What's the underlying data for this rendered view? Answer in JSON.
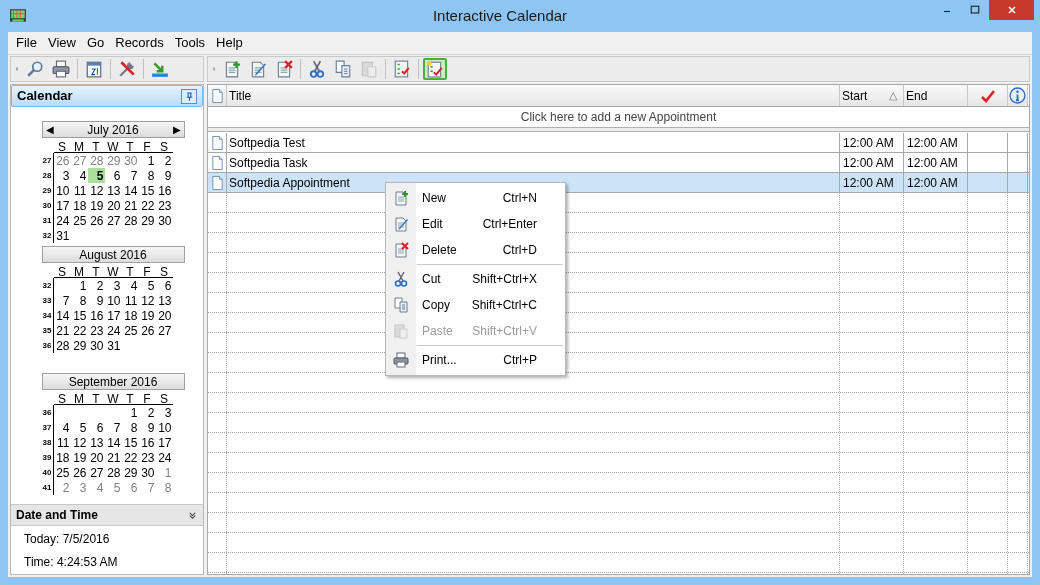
{
  "window": {
    "title": "Interactive Calendar"
  },
  "menu": [
    {
      "label": "File"
    },
    {
      "label": "View"
    },
    {
      "label": "Go"
    },
    {
      "label": "Records"
    },
    {
      "label": "Tools"
    },
    {
      "label": "Help"
    }
  ],
  "left_toolbar": [
    {
      "kind": "search",
      "on": false
    },
    {
      "kind": "print",
      "on": false
    },
    {
      "kind": "calendar",
      "on": false
    },
    {
      "kind": "tools",
      "on": false
    },
    {
      "kind": "export",
      "on": false
    }
  ],
  "right_toolbar": [
    {
      "kind": "new",
      "on": false,
      "disabled": false
    },
    {
      "kind": "edit",
      "on": false,
      "disabled": false
    },
    {
      "kind": "delete",
      "on": false,
      "disabled": false
    },
    {
      "kind": "separator"
    },
    {
      "kind": "cut",
      "on": false,
      "disabled": false
    },
    {
      "kind": "copy",
      "on": false,
      "disabled": false
    },
    {
      "kind": "paste",
      "on": false,
      "disabled": true
    },
    {
      "kind": "separator"
    },
    {
      "kind": "tasks",
      "on": false,
      "disabled": false
    },
    {
      "kind": "separator"
    },
    {
      "kind": "checklist",
      "on": true,
      "disabled": false
    }
  ],
  "calendar": {
    "title": "Calendar",
    "months": [
      {
        "title": "July 2016",
        "prev": "◀",
        "next": "▶",
        "weekdays": [
          "S",
          "M",
          "T",
          "W",
          "T",
          "F",
          "S"
        ],
        "weeks": [
          {
            "number": "27",
            "days": [
              {
                "text": "26",
                "kind": "adjacent",
                "selected": false
              },
              {
                "text": "27",
                "kind": "adjacent",
                "selected": false
              },
              {
                "text": "28",
                "kind": "adjacent",
                "selected": false
              },
              {
                "text": "29",
                "kind": "adjacent",
                "selected": false
              },
              {
                "text": "30",
                "kind": "adjacent",
                "selected": false
              },
              {
                "text": "1",
                "kind": "day",
                "selected": false
              },
              {
                "text": "2",
                "kind": "day",
                "selected": false
              }
            ]
          },
          {
            "number": "28",
            "days": [
              {
                "text": "3",
                "kind": "day",
                "selected": false
              },
              {
                "text": "4",
                "kind": "day",
                "selected": false
              },
              {
                "text": "5",
                "kind": "day",
                "selected": true
              },
              {
                "text": "6",
                "kind": "day",
                "selected": false
              },
              {
                "text": "7",
                "kind": "day",
                "selected": false
              },
              {
                "text": "8",
                "kind": "day",
                "selected": false
              },
              {
                "text": "9",
                "kind": "day",
                "selected": false
              }
            ]
          },
          {
            "number": "29",
            "days": [
              {
                "text": "10",
                "kind": "day",
                "selected": false
              },
              {
                "text": "11",
                "kind": "day",
                "selected": false
              },
              {
                "text": "12",
                "kind": "day",
                "selected": false
              },
              {
                "text": "13",
                "kind": "day",
                "selected": false
              },
              {
                "text": "14",
                "kind": "day",
                "selected": false
              },
              {
                "text": "15",
                "kind": "day",
                "selected": false
              },
              {
                "text": "16",
                "kind": "day",
                "selected": false
              }
            ]
          },
          {
            "number": "30",
            "days": [
              {
                "text": "17",
                "kind": "day",
                "selected": false
              },
              {
                "text": "18",
                "kind": "day",
                "selected": false
              },
              {
                "text": "19",
                "kind": "day",
                "selected": false
              },
              {
                "text": "20",
                "kind": "day",
                "selected": false
              },
              {
                "text": "21",
                "kind": "day",
                "selected": false
              },
              {
                "text": "22",
                "kind": "day",
                "selected": false
              },
              {
                "text": "23",
                "kind": "day",
                "selected": false
              }
            ]
          },
          {
            "number": "31",
            "days": [
              {
                "text": "24",
                "kind": "day",
                "selected": false
              },
              {
                "text": "25",
                "kind": "day",
                "selected": false
              },
              {
                "text": "26",
                "kind": "day",
                "selected": false
              },
              {
                "text": "27",
                "kind": "day",
                "selected": false
              },
              {
                "text": "28",
                "kind": "day",
                "selected": false
              },
              {
                "text": "29",
                "kind": "day",
                "selected": false
              },
              {
                "text": "30",
                "kind": "day",
                "selected": false
              }
            ]
          },
          {
            "number": "32",
            "days": [
              {
                "text": "31",
                "kind": "day",
                "selected": false
              }
            ]
          }
        ]
      },
      {
        "title": "August 2016",
        "weekdays": [
          "S",
          "M",
          "T",
          "W",
          "T",
          "F",
          "S"
        ],
        "weeks": [
          {
            "number": "32",
            "days": [
              {
                "kind": "blank"
              },
              {
                "text": "1",
                "kind": "day",
                "selected": false
              },
              {
                "text": "2",
                "kind": "day",
                "selected": false
              },
              {
                "text": "3",
                "kind": "day",
                "selected": false
              },
              {
                "text": "4",
                "kind": "day",
                "selected": false
              },
              {
                "text": "5",
                "kind": "day",
                "selected": false
              },
              {
                "text": "6",
                "kind": "day",
                "selected": false
              }
            ]
          },
          {
            "number": "33",
            "days": [
              {
                "text": "7",
                "kind": "day",
                "selected": false
              },
              {
                "text": "8",
                "kind": "day",
                "selected": false
              },
              {
                "text": "9",
                "kind": "day",
                "selected": false
              },
              {
                "text": "10",
                "kind": "day",
                "selected": false
              },
              {
                "text": "11",
                "kind": "day",
                "selected": false
              },
              {
                "text": "12",
                "kind": "day",
                "selected": false
              },
              {
                "text": "13",
                "kind": "day",
                "selected": false
              }
            ]
          },
          {
            "number": "34",
            "days": [
              {
                "text": "14",
                "kind": "day",
                "selected": false
              },
              {
                "text": "15",
                "kind": "day",
                "selected": false
              },
              {
                "text": "16",
                "kind": "day",
                "selected": false
              },
              {
                "text": "17",
                "kind": "day",
                "selected": false
              },
              {
                "text": "18",
                "kind": "day",
                "selected": false
              },
              {
                "text": "19",
                "kind": "day",
                "selected": false
              },
              {
                "text": "20",
                "kind": "day",
                "selected": false
              }
            ]
          },
          {
            "number": "35",
            "days": [
              {
                "text": "21",
                "kind": "day",
                "selected": false
              },
              {
                "text": "22",
                "kind": "day",
                "selected": false
              },
              {
                "text": "23",
                "kind": "day",
                "selected": false
              },
              {
                "text": "24",
                "kind": "day",
                "selected": false
              },
              {
                "text": "25",
                "kind": "day",
                "selected": false
              },
              {
                "text": "26",
                "kind": "day",
                "selected": false
              },
              {
                "text": "27",
                "kind": "day",
                "selected": false
              }
            ]
          },
          {
            "number": "36",
            "days": [
              {
                "text": "28",
                "kind": "day",
                "selected": false
              },
              {
                "text": "29",
                "kind": "day",
                "selected": false
              },
              {
                "text": "30",
                "kind": "day",
                "selected": false
              },
              {
                "text": "31",
                "kind": "day",
                "selected": false
              }
            ]
          }
        ]
      },
      {
        "title": "September 2016",
        "weekdays": [
          "S",
          "M",
          "T",
          "W",
          "T",
          "F",
          "S"
        ],
        "weeks": [
          {
            "number": "36",
            "days": [
              {
                "kind": "blank"
              },
              {
                "kind": "blank"
              },
              {
                "kind": "blank"
              },
              {
                "kind": "blank"
              },
              {
                "text": "1",
                "kind": "day",
                "selected": false
              },
              {
                "text": "2",
                "kind": "day",
                "selected": false
              },
              {
                "text": "3",
                "kind": "day",
                "selected": false
              }
            ]
          },
          {
            "number": "37",
            "days": [
              {
                "text": "4",
                "kind": "day",
                "selected": false
              },
              {
                "text": "5",
                "kind": "day",
                "selected": false
              },
              {
                "text": "6",
                "kind": "day",
                "selected": false
              },
              {
                "text": "7",
                "kind": "day",
                "selected": false
              },
              {
                "text": "8",
                "kind": "day",
                "selected": false
              },
              {
                "text": "9",
                "kind": "day",
                "selected": false
              },
              {
                "text": "10",
                "kind": "day",
                "selected": false
              }
            ]
          },
          {
            "number": "38",
            "days": [
              {
                "text": "11",
                "kind": "day",
                "selected": false
              },
              {
                "text": "12",
                "kind": "day",
                "selected": false
              },
              {
                "text": "13",
                "kind": "day",
                "selected": false
              },
              {
                "text": "14",
                "kind": "day",
                "selected": false
              },
              {
                "text": "15",
                "kind": "day",
                "selected": false
              },
              {
                "text": "16",
                "kind": "day",
                "selected": false
              },
              {
                "text": "17",
                "kind": "day",
                "selected": false
              }
            ]
          },
          {
            "number": "39",
            "days": [
              {
                "text": "18",
                "kind": "day",
                "selected": false
              },
              {
                "text": "19",
                "kind": "day",
                "selected": false
              },
              {
                "text": "20",
                "kind": "day",
                "selected": false
              },
              {
                "text": "21",
                "kind": "day",
                "selected": false
              },
              {
                "text": "22",
                "kind": "day",
                "selected": false
              },
              {
                "text": "23",
                "kind": "day",
                "selected": false
              },
              {
                "text": "24",
                "kind": "day",
                "selected": false
              }
            ]
          },
          {
            "number": "40",
            "days": [
              {
                "text": "25",
                "kind": "day",
                "selected": false
              },
              {
                "text": "26",
                "kind": "day",
                "selected": false
              },
              {
                "text": "27",
                "kind": "day",
                "selected": false
              },
              {
                "text": "28",
                "kind": "day",
                "selected": false
              },
              {
                "text": "29",
                "kind": "day",
                "selected": false
              },
              {
                "text": "30",
                "kind": "day",
                "selected": false
              },
              {
                "text": "1",
                "kind": "adjacent",
                "selected": false
              }
            ]
          },
          {
            "number": "41",
            "days": [
              {
                "text": "2",
                "kind": "adjacent",
                "selected": false
              },
              {
                "text": "3",
                "kind": "adjacent",
                "selected": false
              },
              {
                "text": "4",
                "kind": "adjacent",
                "selected": false
              },
              {
                "text": "5",
                "kind": "adjacent",
                "selected": false
              },
              {
                "text": "6",
                "kind": "adjacent",
                "selected": false
              },
              {
                "text": "7",
                "kind": "adjacent",
                "selected": false
              },
              {
                "text": "8",
                "kind": "adjacent",
                "selected": false
              }
            ]
          }
        ]
      }
    ]
  },
  "date_time": {
    "title": "Date and Time",
    "lines": [
      "Today: 7/5/2016",
      "Time: 4:24:53 AM"
    ]
  },
  "table": {
    "columns": [
      {
        "label": "Title"
      },
      {
        "label": "Start",
        "sort": "△"
      },
      {
        "label": "End"
      }
    ],
    "add_row": "Click here to add a new Appointment",
    "rows": [
      {
        "title": "Softpedia Test",
        "start": "12:00 AM",
        "end": "12:00 AM",
        "selected": false
      },
      {
        "title": "Softpedia Task",
        "start": "12:00 AM",
        "end": "12:00 AM",
        "selected": false
      },
      {
        "title": "Softpedia Appointment",
        "start": "12:00 AM",
        "end": "12:00 AM",
        "selected": true
      }
    ]
  },
  "context_menu": [
    {
      "kind": "new",
      "label": "New",
      "shortcut": "Ctrl+N",
      "disabled": false
    },
    {
      "kind": "edit",
      "label": "Edit",
      "shortcut": "Ctrl+Enter",
      "disabled": false
    },
    {
      "kind": "delete",
      "label": "Delete",
      "shortcut": "Ctrl+D",
      "disabled": false
    },
    {
      "kind": "separator"
    },
    {
      "kind": "cut",
      "label": "Cut",
      "shortcut": "Shift+Ctrl+X",
      "disabled": false
    },
    {
      "kind": "copy",
      "label": "Copy",
      "shortcut": "Shift+Ctrl+C",
      "disabled": false
    },
    {
      "kind": "paste",
      "label": "Paste",
      "shortcut": "Shift+Ctrl+V",
      "disabled": true
    },
    {
      "kind": "separator"
    },
    {
      "kind": "print",
      "label": "Print...",
      "shortcut": "Ctrl+P",
      "disabled": false
    }
  ]
}
